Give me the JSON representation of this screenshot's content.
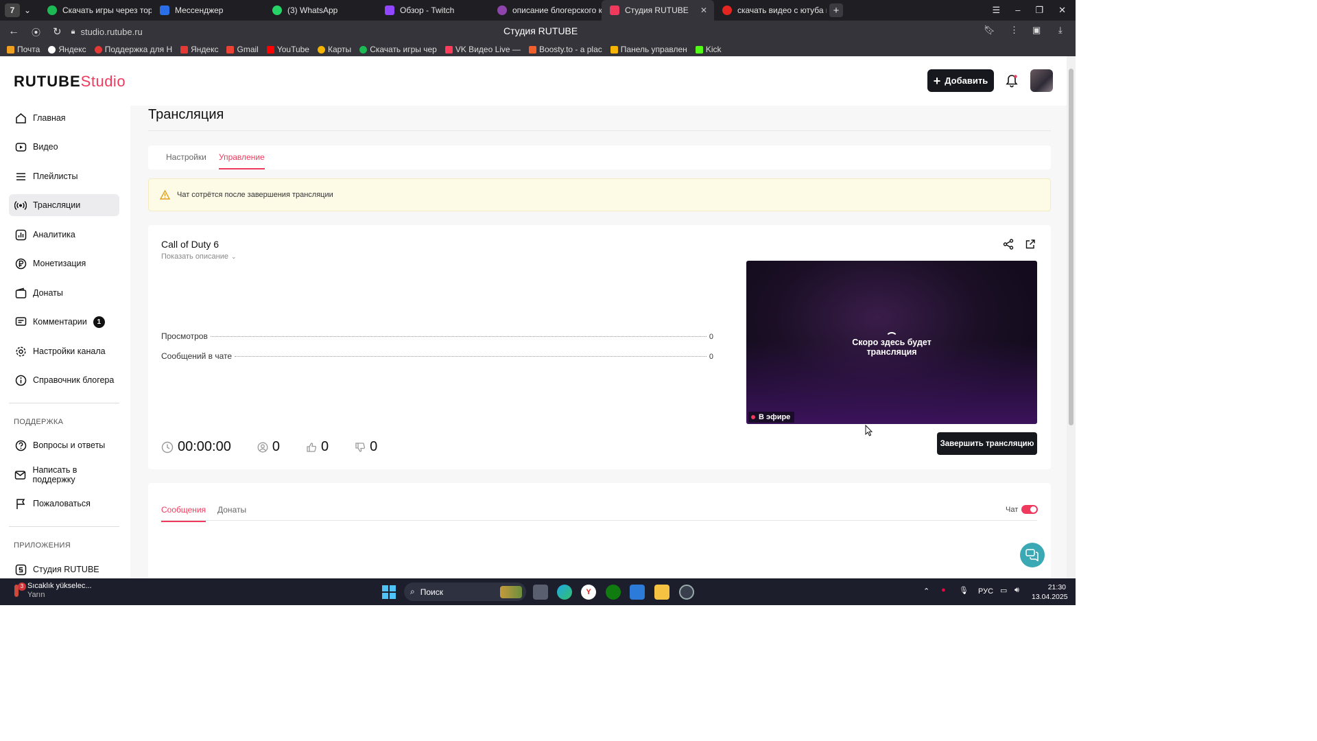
{
  "browser": {
    "tab_counter": "7",
    "tabs": [
      {
        "label": "Скачать игры через торр",
        "color": "#1db954"
      },
      {
        "label": "Мессенджер",
        "color": "#2a6fe8"
      },
      {
        "label": "(3) WhatsApp",
        "color": "#25d366"
      },
      {
        "label": "Обзор - Twitch",
        "color": "#9146ff"
      },
      {
        "label": "описание блогерского ка",
        "color": "#8e44ad"
      },
      {
        "label": "Студия RUTUBE",
        "color": "#ef3a5d"
      },
      {
        "label": "скачать видео с ютуба по",
        "color": "#e52620"
      }
    ],
    "address": "studio.rutube.ru",
    "page_title": "Студия RUTUBE",
    "bookmarks": [
      {
        "label": "Почта",
        "color": "#f0a020"
      },
      {
        "label": "Яндекс",
        "color": "#ffffff"
      },
      {
        "label": "Поддержка для Н",
        "color": "#e53935"
      },
      {
        "label": "Яндекс",
        "color": "#e53935"
      },
      {
        "label": "Gmail",
        "color": "#ea4335"
      },
      {
        "label": "YouTube",
        "color": "#ff0000"
      },
      {
        "label": "Карты",
        "color": "#f5b400"
      },
      {
        "label": "Скачать игры чер",
        "color": "#1db954"
      },
      {
        "label": "VK Видео Live — ",
        "color": "#ff3d5a"
      },
      {
        "label": "Boosty.to - a plac",
        "color": "#f15f2c"
      },
      {
        "label": "Панель управлен",
        "color": "#f5b400"
      },
      {
        "label": "Kick",
        "color": "#53fc18"
      }
    ]
  },
  "header": {
    "logo_main": "RUTUBE",
    "logo_sub": "Studio",
    "add_label": "Добавить"
  },
  "sidebar": {
    "items": [
      {
        "label": "Главная",
        "icon": "home-icon"
      },
      {
        "label": "Видео",
        "icon": "video-icon"
      },
      {
        "label": "Плейлисты",
        "icon": "playlist-icon"
      },
      {
        "label": "Трансляции",
        "icon": "broadcast-icon"
      },
      {
        "label": "Аналитика",
        "icon": "analytics-icon"
      },
      {
        "label": "Монетизация",
        "icon": "ruble-icon"
      },
      {
        "label": "Донаты",
        "icon": "wallet-icon"
      },
      {
        "label": "Комментарии",
        "icon": "comments-icon",
        "badge": "1"
      },
      {
        "label": "Настройки канала",
        "icon": "gear-icon"
      },
      {
        "label": "Справочник блогера",
        "icon": "info-icon"
      }
    ],
    "support_heading": "ПОДДЕРЖКА",
    "support_items": [
      {
        "label": "Вопросы и ответы",
        "icon": "question-icon"
      },
      {
        "label": "Написать в поддержку",
        "icon": "mail-icon"
      },
      {
        "label": "Пожаловаться",
        "icon": "flag-icon"
      }
    ],
    "apps_heading": "ПРИЛОЖЕНИЯ",
    "apps_items": [
      {
        "label": "Студия RUTUBE",
        "icon": "studio-icon"
      }
    ]
  },
  "main": {
    "title": "Трансляция",
    "tabs": [
      "Настройки",
      "Управление"
    ],
    "alert": "Чат сотрётся после завершения трансляции",
    "stream": {
      "title": "Call of Duty 6",
      "show_description": "Показать описание",
      "views_label": "Просмотров",
      "views_value": "0",
      "messages_label": "Сообщений в чате",
      "messages_value": "0",
      "player_text_line1": "Скоро здесь будет",
      "player_text_line2": "трансляция",
      "live_label": "В эфире",
      "duration": "00:00:00",
      "viewers": "0",
      "likes": "0",
      "dislikes": "0",
      "end_button": "Завершить трансляцию"
    },
    "chat": {
      "tabs": [
        "Сообщения",
        "Донаты"
      ],
      "toggle_label": "Чат",
      "toggle_on": true
    }
  },
  "taskbar": {
    "weather_line1": "Sıcaklık yükselec...",
    "weather_line2": "Yarın",
    "weather_badge": "3",
    "search_label": "Поиск",
    "lang": "РУС",
    "time": "21:30",
    "date": "13.04.2025"
  },
  "colors": {
    "accent": "#ef3a5d",
    "dark_button": "#16181d",
    "help_button": "#3aa9b4"
  }
}
